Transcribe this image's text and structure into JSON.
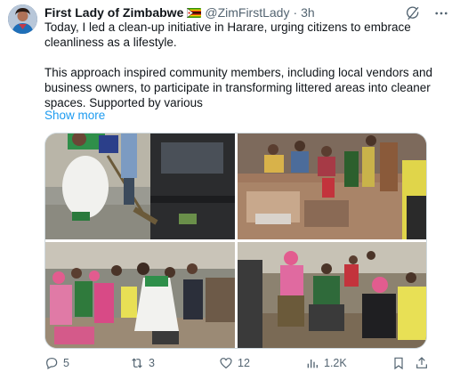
{
  "post": {
    "author_name": "First Lady of Zimbabwe",
    "handle": "@ZimFirstLady",
    "separator": "·",
    "time": "3h",
    "paragraphs": [
      "Today, I led a clean-up initiative in Harare, urging citizens to embrace cleanliness as a lifestyle.",
      "This approach inspired community members, including local vendors and business owners, to participate in transforming littered areas into cleaner spaces. Supported by various"
    ],
    "show_more": "Show more",
    "flag_icon": "zimbabwe-flag-icon"
  },
  "media": {
    "photos": [
      {
        "name": "photo-woman-sweeping"
      },
      {
        "name": "photo-crowd-clearing-litter"
      },
      {
        "name": "photo-crowd-cleanup"
      },
      {
        "name": "photo-collecting-rubbish"
      }
    ]
  },
  "actions": {
    "replies": "5",
    "reposts": "3",
    "likes": "12",
    "views": "1.2K"
  },
  "colors": {
    "text": "#0f1419",
    "secondary": "#536471",
    "link": "#1d9bf0",
    "border": "#cfd9de"
  }
}
